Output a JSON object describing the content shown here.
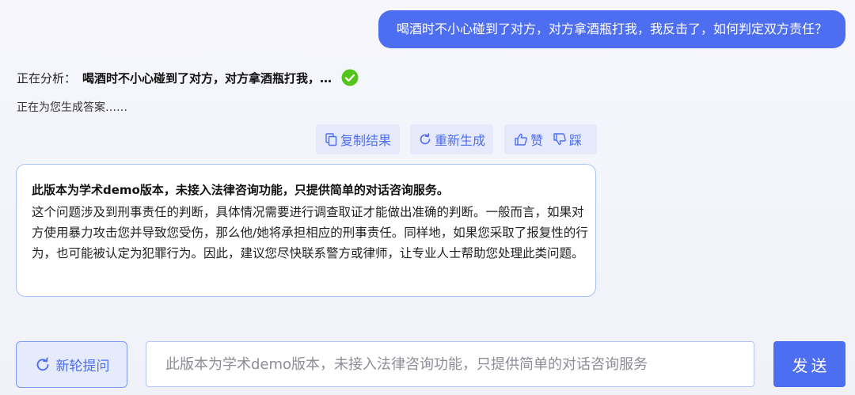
{
  "user_message": "喝酒时不小心碰到了对方，对方拿酒瓶打我，我反击了，如何判定双方责任？",
  "analysis": {
    "label": "正在分析：",
    "query": "喝酒时不小心碰到了对方，对方拿酒瓶打我，…",
    "status_icon": "check-circle-icon",
    "status_color": "#52c41a"
  },
  "generating_text": "正在为您生成答案……",
  "actions": {
    "copy": {
      "label": "复制结果",
      "icon": "copy-icon"
    },
    "regenerate": {
      "label": "重新生成",
      "icon": "refresh-icon"
    },
    "like": {
      "label": "赞",
      "icon": "thumbs-up-icon"
    },
    "dislike": {
      "label": "踩",
      "icon": "thumbs-down-icon"
    }
  },
  "answer": {
    "title": "此版本为学术demo版本，未接入法律咨询功能，只提供简单的对话咨询服务。",
    "body": "这个问题涉及到刑事责任的判断，具体情况需要进行调查取证才能做出准确的判断。一般而言，如果对方使用暴力攻击您并导致您受伤，那么他/她将承担相应的刑事责任。同样地，如果您采取了报复性的行为，也可能被认定为犯罪行为。因此，建议您尽快联系警方或律师，让专业人士帮助您处理此类问题。"
  },
  "footer": {
    "new_topic_label": "新轮提问",
    "new_topic_icon": "refresh-icon",
    "input_value": "",
    "input_placeholder": "此版本为学术demo版本，未接入法律咨询功能，只提供简单的对话咨询服务",
    "send_label": "发送"
  },
  "colors": {
    "accent": "#4e6ef2",
    "button_bg": "#e5e9f9",
    "card_border": "#a9c3f6"
  }
}
